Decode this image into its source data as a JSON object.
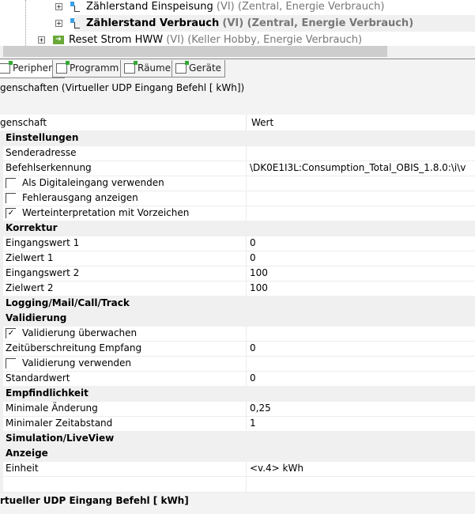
{
  "tree": [
    {
      "name": "Zählerstand Einspeisung",
      "suffix": "(VI) (Zentral, Energie Verbrauch)"
    },
    {
      "name": "Zählerstand Verbrauch",
      "suffix": "(VI) (Zentral, Energie Verbrauch)"
    },
    {
      "name": "Reset Strom HWW",
      "suffix": "(VI) (Keller Hobby, Energie Verbrauch)"
    }
  ],
  "tabs": [
    "Peripherie",
    "Programm",
    "Räume",
    "Geräte"
  ],
  "panel_title": "genschaften (Virtueller UDP Eingang Befehl [ kWh])",
  "grid": {
    "col_property": "genschaft",
    "col_value": "Wert",
    "rows": [
      {
        "label": "Einstellungen",
        "cat": true
      },
      {
        "label": "Senderadresse",
        "value": ""
      },
      {
        "label": "Befehlserkennung",
        "value": "\\DK0E1I3L:Consumption_Total_OBIS_1.8.0:\\i\\v"
      },
      {
        "label": "Als Digitaleingang verwenden",
        "check": false
      },
      {
        "label": "Fehlerausgang anzeigen",
        "check": false
      },
      {
        "label": "Werteinterpretation mit Vorzeichen",
        "check": true
      },
      {
        "label": "Korrektur",
        "cat": true
      },
      {
        "label": "Eingangswert 1",
        "value": "0"
      },
      {
        "label": "Zielwert 1",
        "value": "0"
      },
      {
        "label": "Eingangswert 2",
        "value": "100"
      },
      {
        "label": "Zielwert 2",
        "value": "100"
      },
      {
        "label": "Logging/Mail/Call/Track",
        "cat": true
      },
      {
        "label": "Validierung",
        "cat": true
      },
      {
        "label": "Validierung überwachen",
        "check": true
      },
      {
        "label": "Zeitüberschreitung Empfang",
        "value": "0"
      },
      {
        "label": "Validierung verwenden",
        "check": false
      },
      {
        "label": "Standardwert",
        "value": "0"
      },
      {
        "label": "Empfindlichkeit",
        "cat": true
      },
      {
        "label": "Minimale Änderung",
        "value": "0,25"
      },
      {
        "label": "Minimaler Zeitabstand",
        "value": "1"
      },
      {
        "label": "Simulation/LiveView",
        "cat": true
      },
      {
        "label": "Anzeige",
        "cat": true
      },
      {
        "label": "Einheit",
        "value": "<v.4> kWh"
      }
    ]
  },
  "status": "rtueller UDP Eingang Befehl [ kWh]"
}
